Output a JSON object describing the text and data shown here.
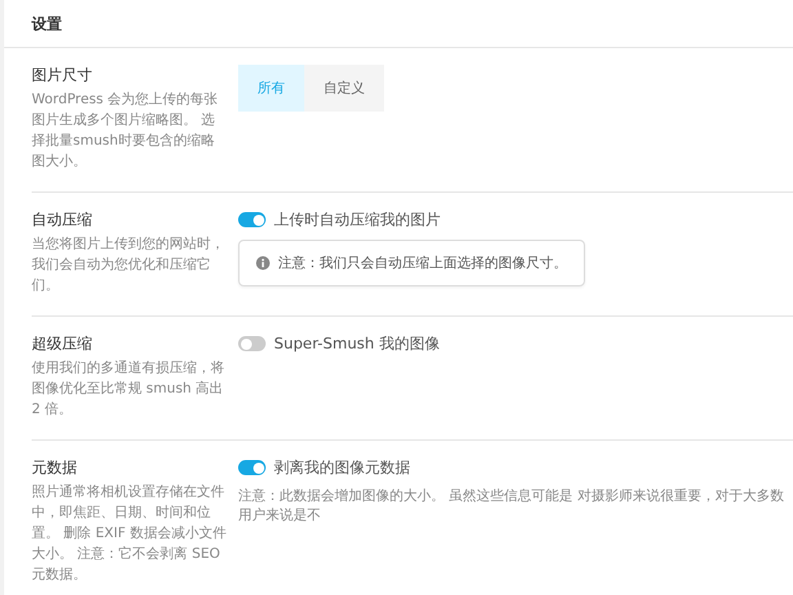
{
  "panel": {
    "title": "设置"
  },
  "settings": [
    {
      "kind": "segmented",
      "title": "图片尺寸",
      "description": "WordPress 会为您上传的每张图片生成多个图片缩略图。 选择批量smush时要包含的缩略图大小。",
      "options": [
        {
          "label": "所有",
          "selected": true
        },
        {
          "label": "自定义",
          "selected": false
        }
      ]
    },
    {
      "kind": "toggle",
      "title": "自动压缩",
      "description": "当您将图片上传到您的网站时，我们会自动为您优化和压缩它们。",
      "on": true,
      "label": "上传时自动压缩我的图片",
      "note": {
        "kind": "box",
        "text": "注意：我们只会自动压缩上面选择的图像尺寸。"
      }
    },
    {
      "kind": "toggle",
      "title": "超级压缩",
      "description": "使用我们的多通道有损压缩，将图像优化至比常规 smush 高出 2 倍。",
      "on": false,
      "label": "Super-Smush 我的图像"
    },
    {
      "kind": "toggle",
      "title": "元数据",
      "description": "照片通常将相机设置存储在文件中，即焦距、日期、时间和位置。 删除 EXIF 数据会减小文件大小。 注意：它不会剥离 SEO 元数据。",
      "on": true,
      "label": "剥离我的图像元数据",
      "note": {
        "kind": "plain",
        "text": "注意：此数据会增加图像的大小。 虽然这些信息可能是 对摄影师来说很重要，对于大多数用户来说是不"
      }
    }
  ]
}
